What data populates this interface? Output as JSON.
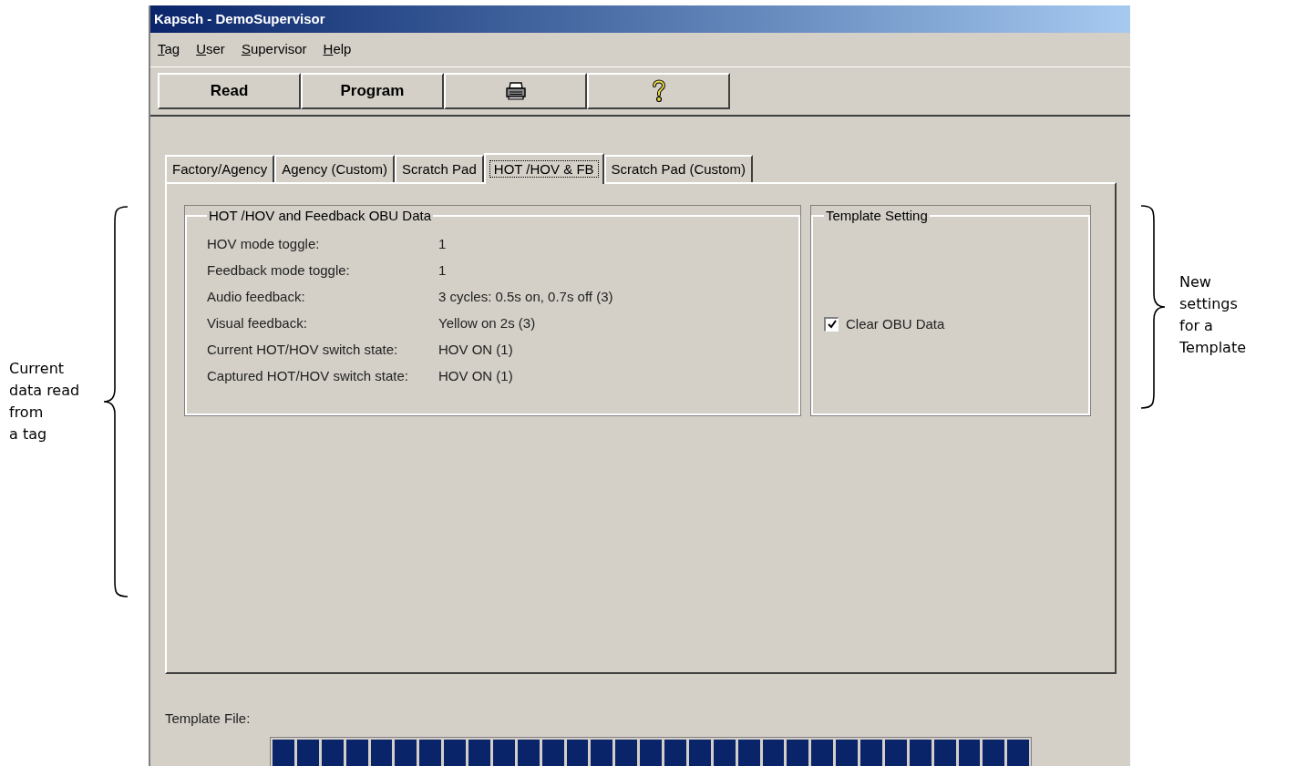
{
  "annotations": {
    "left": {
      "lines": [
        "Current",
        "data read",
        "from",
        "a tag"
      ]
    },
    "right": {
      "lines": [
        "New",
        "settings",
        "for a",
        "Template"
      ]
    }
  },
  "window": {
    "title": "Kapsch - DemoSupervisor"
  },
  "menu": [
    {
      "label": "Tag"
    },
    {
      "label": "User"
    },
    {
      "label": "Supervisor"
    },
    {
      "label": "Help"
    }
  ],
  "toolbar": [
    {
      "kind": "text",
      "label": "Read"
    },
    {
      "kind": "text",
      "label": "Program"
    },
    {
      "kind": "printer"
    },
    {
      "kind": "help"
    }
  ],
  "tabs": [
    {
      "label": "Factory/Agency",
      "selected": false
    },
    {
      "label": "Agency (Custom)",
      "selected": false
    },
    {
      "label": "Scratch Pad",
      "selected": false
    },
    {
      "label": "HOT /HOV & FB",
      "selected": true
    },
    {
      "label": "Scratch Pad (Custom)",
      "selected": false
    }
  ],
  "obu_group": {
    "title": "HOT /HOV and Feedback OBU Data",
    "rows": [
      {
        "label": "HOV mode toggle:",
        "value": "1"
      },
      {
        "label": "Feedback mode toggle:",
        "value": "1"
      },
      {
        "label": "Audio feedback:",
        "value": "3 cycles: 0.5s on, 0.7s off (3)"
      },
      {
        "label": "Visual feedback:",
        "value": "Yellow on 2s (3)"
      },
      {
        "label": "Current HOT/HOV switch state:",
        "value": "HOV ON (1)"
      },
      {
        "label": "Captured HOT/HOV switch state:",
        "value": "HOV ON (1)"
      }
    ]
  },
  "template_group": {
    "title": "Template Setting",
    "checkbox": {
      "label": "Clear OBU Data",
      "checked": true
    }
  },
  "template_file": {
    "label": "Template File:",
    "progress": {
      "level": 1
    }
  }
}
